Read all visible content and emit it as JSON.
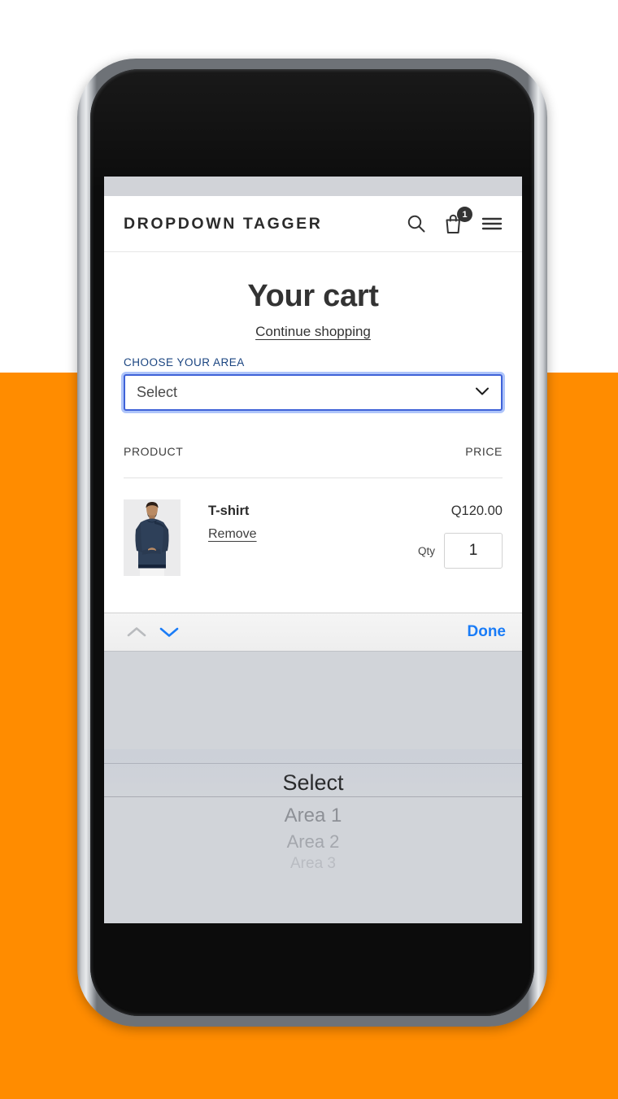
{
  "background": {
    "top_color": "#ffffff",
    "bottom_color": "#ff8c00"
  },
  "device": {
    "type": "smartphone-mockup",
    "frame_color": "#8d9196"
  },
  "header": {
    "brand": "DROPDOWN TAGGER",
    "icons": [
      {
        "name": "search-icon",
        "label": "Search"
      },
      {
        "name": "cart-icon",
        "label": "Cart"
      },
      {
        "name": "menu-icon",
        "label": "Menu"
      }
    ],
    "cart_badge_count": "1"
  },
  "cart": {
    "title": "Your cart",
    "continue_shopping": "Continue shopping",
    "area_label": "CHOOSE YOUR AREA",
    "area_label_color": "#1a4480",
    "area_select_value": "Select",
    "table_headers": {
      "product": "PRODUCT",
      "price": "PRICE"
    },
    "items": [
      {
        "title": "T-shirt",
        "remove_label": "Remove",
        "price": "Q120.00",
        "qty_label": "Qty",
        "qty_value": "1",
        "thumbnail_alt": "man-wearing-navy-long-sleeve-shirt"
      }
    ]
  },
  "picker": {
    "toolbar": {
      "prev_icon": "chevron-up-icon",
      "next_icon": "chevron-down-icon",
      "prev_enabled": false,
      "next_enabled": true,
      "done_label": "Done",
      "done_color": "#1a7cf7"
    },
    "selected_index": 0,
    "options": [
      "Select",
      "Area 1",
      "Area 2",
      "Area 3"
    ],
    "background_color": "#d1d4d9"
  }
}
